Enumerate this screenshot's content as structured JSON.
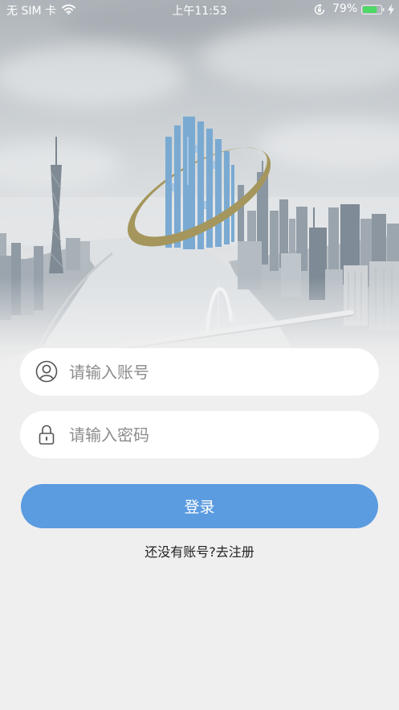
{
  "status_bar": {
    "carrier": "无 SIM 卡",
    "time": "上午11:53",
    "battery_text": "79%",
    "battery_level": 0.79,
    "charging": true
  },
  "login_form": {
    "account": {
      "placeholder": "请输入账号",
      "value": "",
      "icon": "user-icon"
    },
    "password": {
      "placeholder": "请输入密码",
      "value": "",
      "icon": "lock-icon"
    },
    "login_label": "登录",
    "register_link": "还没有账号?去注册"
  },
  "icons": {
    "wifi": "wifi-icon",
    "rotation_lock": "rotation-lock-icon",
    "battery": "battery-icon",
    "charging": "charging-icon",
    "logo": "app-logo"
  },
  "colors": {
    "primary": "#5b9be0",
    "page_background": "#efefef",
    "field_background": "#ffffff",
    "logo_blue": "#7aaad2",
    "logo_gold": "#a4965c",
    "battery": "#4cd964"
  }
}
